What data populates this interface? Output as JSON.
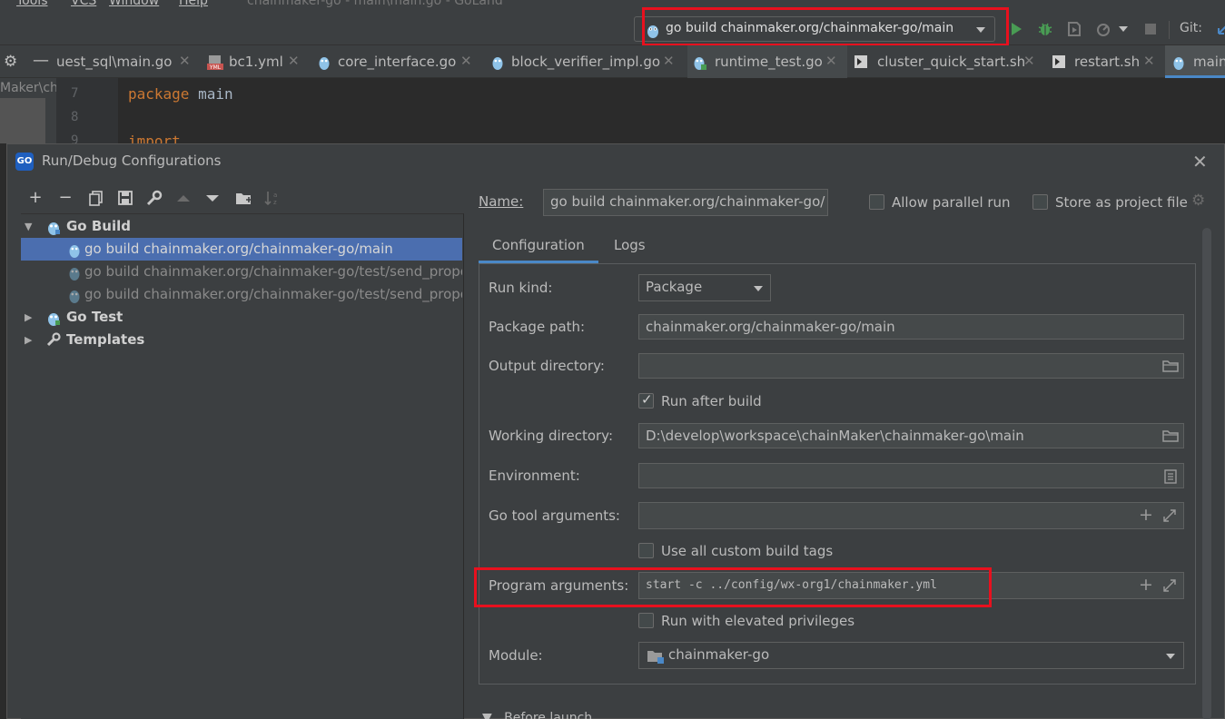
{
  "menubar": {
    "items": [
      "Tools",
      "VCS",
      "Window",
      "Help"
    ],
    "title": "chainmaker-go - main\\main.go - GoLand"
  },
  "toolbar": {
    "run_config": "go build chainmaker.org/chainmaker-go/main",
    "git_label": "Git:"
  },
  "tabs": [
    {
      "label": "uest_sql\\main.go"
    },
    {
      "label": "bc1.yml"
    },
    {
      "label": "core_interface.go"
    },
    {
      "label": "block_verifier_impl.go"
    },
    {
      "label": "runtime_test.go"
    },
    {
      "label": "cluster_quick_start.sh"
    },
    {
      "label": "restart.sh"
    },
    {
      "label": "main"
    }
  ],
  "project_strip": {
    "text": "Maker\\ch"
  },
  "editor": {
    "lines": [
      {
        "number": "7",
        "keyword": "package",
        "ident": "main"
      },
      {
        "number": "8",
        "keyword": "",
        "ident": ""
      },
      {
        "number": "9",
        "keyword": "import",
        "ident": ""
      }
    ]
  },
  "dialog": {
    "title": "Run/Debug Configurations",
    "title_icon": "GO",
    "tree": {
      "go_build": "Go Build",
      "items": [
        "go build chainmaker.org/chainmaker-go/main",
        "go build chainmaker.org/chainmaker-go/test/send_propo",
        "go build chainmaker.org/chainmaker-go/test/send_propo"
      ],
      "go_test": "Go Test",
      "templates": "Templates"
    },
    "name_label": "Name:",
    "name_value": "go build chainmaker.org/chainmaker-go/",
    "allow_parallel": "Allow parallel run",
    "store_as_project": "Store as project file",
    "tabs": {
      "configuration": "Configuration",
      "logs": "Logs"
    },
    "form": {
      "run_kind_label": "Run kind:",
      "run_kind_value": "Package",
      "package_path_label": "Package path:",
      "package_path_value": "chainmaker.org/chainmaker-go/main",
      "output_dir_label": "Output directory:",
      "output_dir_value": "",
      "run_after_build": "Run after build",
      "working_dir_label": "Working directory:",
      "working_dir_value": "D:\\develop\\workspace\\chainMaker\\chainmaker-go\\main",
      "environment_label": "Environment:",
      "environment_value": "",
      "go_tool_args_label": "Go tool arguments:",
      "go_tool_args_value": "",
      "use_custom_tags": "Use all custom build tags",
      "program_args_label": "Program arguments:",
      "program_args_value": "start -c ../config/wx-org1/chainmaker.yml",
      "elevated": "Run with elevated privileges",
      "module_label": "Module:",
      "module_value": "chainmaker-go"
    },
    "before_launch": "Before launch"
  },
  "colors": {
    "highlight": "#e8101e",
    "selection": "#4b6eaf",
    "accent": "#4a88c7",
    "run_green": "#499c54"
  }
}
